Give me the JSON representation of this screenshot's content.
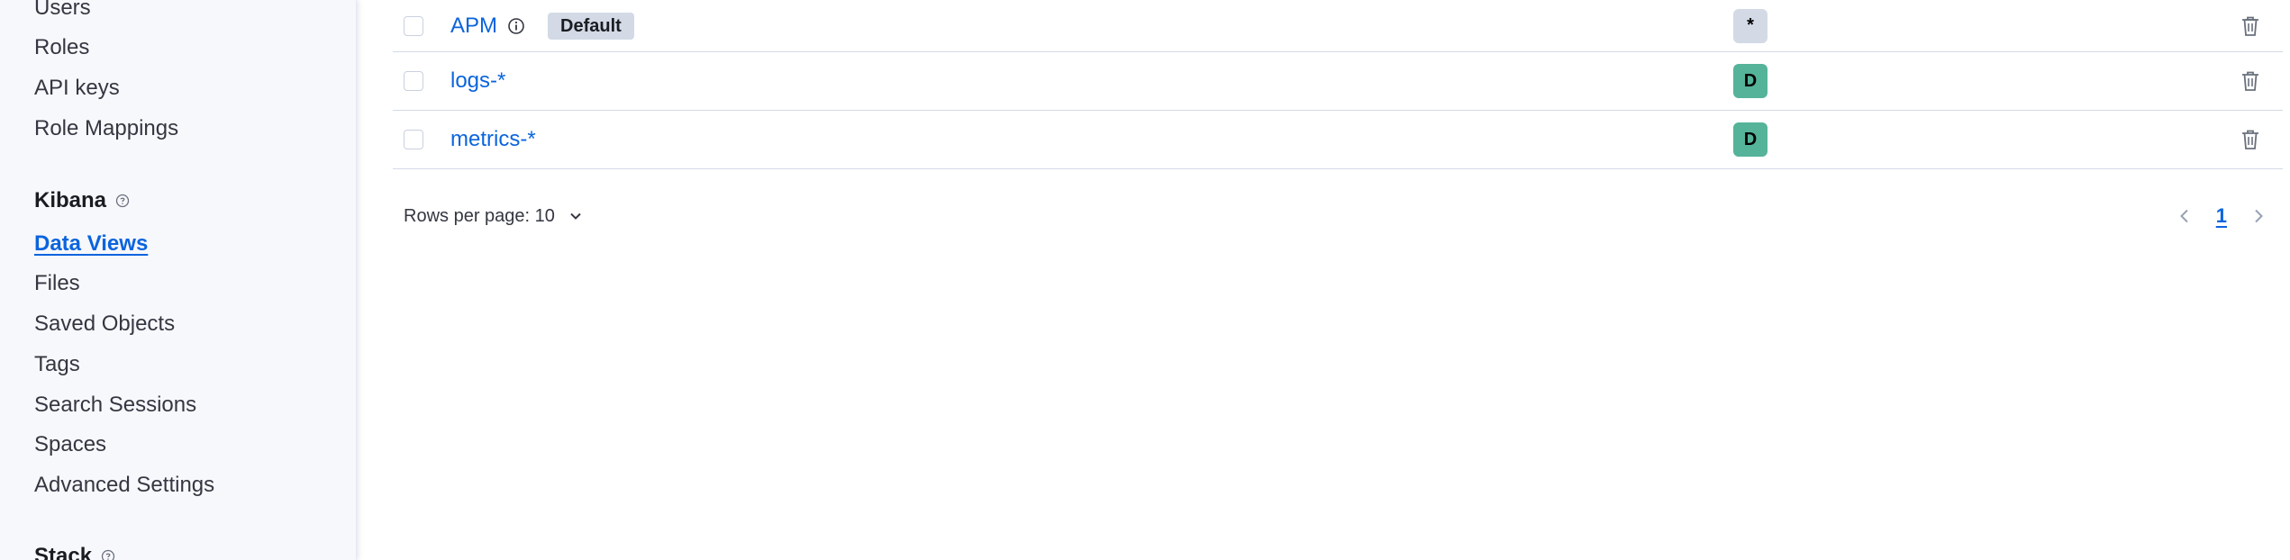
{
  "sidebar": {
    "security_items": [
      "Users",
      "Roles",
      "API keys",
      "Role Mappings"
    ],
    "kibana_title": "Kibana",
    "kibana_items": [
      {
        "label": "Data Views",
        "active": true
      },
      {
        "label": "Files",
        "active": false
      },
      {
        "label": "Saved Objects",
        "active": false
      },
      {
        "label": "Tags",
        "active": false
      },
      {
        "label": "Search Sessions",
        "active": false
      },
      {
        "label": "Spaces",
        "active": false
      },
      {
        "label": "Advanced Settings",
        "active": false
      }
    ],
    "stack_title": "Stack"
  },
  "table": {
    "rows": [
      {
        "name": "APM",
        "info_icon": "info-icon",
        "badge": "Default",
        "space": "*",
        "space_color": "#d3dae6"
      },
      {
        "name": "logs-*",
        "space": "D",
        "space_color": "#54b399"
      },
      {
        "name": "metrics-*",
        "space": "D",
        "space_color": "#54b399"
      }
    ]
  },
  "pagination": {
    "rows_per_page_label": "Rows per page: 10",
    "current_page": "1"
  },
  "colors": {
    "link": "#0b64dd",
    "border": "#d3dae6",
    "badge_bg": "#d3dae6",
    "space_default": "#54b399"
  }
}
